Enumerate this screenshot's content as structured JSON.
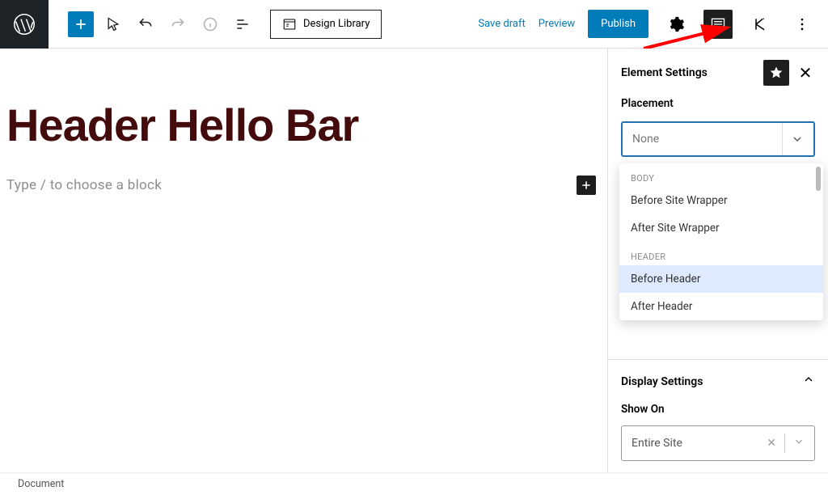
{
  "toolbar": {
    "design_library_label": "Design Library",
    "save_draft_label": "Save draft",
    "preview_label": "Preview",
    "publish_label": "Publish"
  },
  "editor": {
    "post_title": "Header Hello Bar",
    "block_prompt": "Type / to choose a block"
  },
  "sidebar": {
    "title": "Element Settings",
    "placement": {
      "label": "Placement",
      "selected": "None",
      "groups": [
        {
          "name": "BODY",
          "options": [
            "Before Site Wrapper",
            "After Site Wrapper"
          ]
        },
        {
          "name": "HEADER",
          "options": [
            "Before Header",
            "After Header"
          ]
        }
      ],
      "highlighted_option": "Before Header"
    },
    "display_settings": {
      "label": "Display Settings",
      "show_on_label": "Show On",
      "show_on_value": "Entire Site"
    }
  },
  "footer": {
    "status": "Document"
  }
}
